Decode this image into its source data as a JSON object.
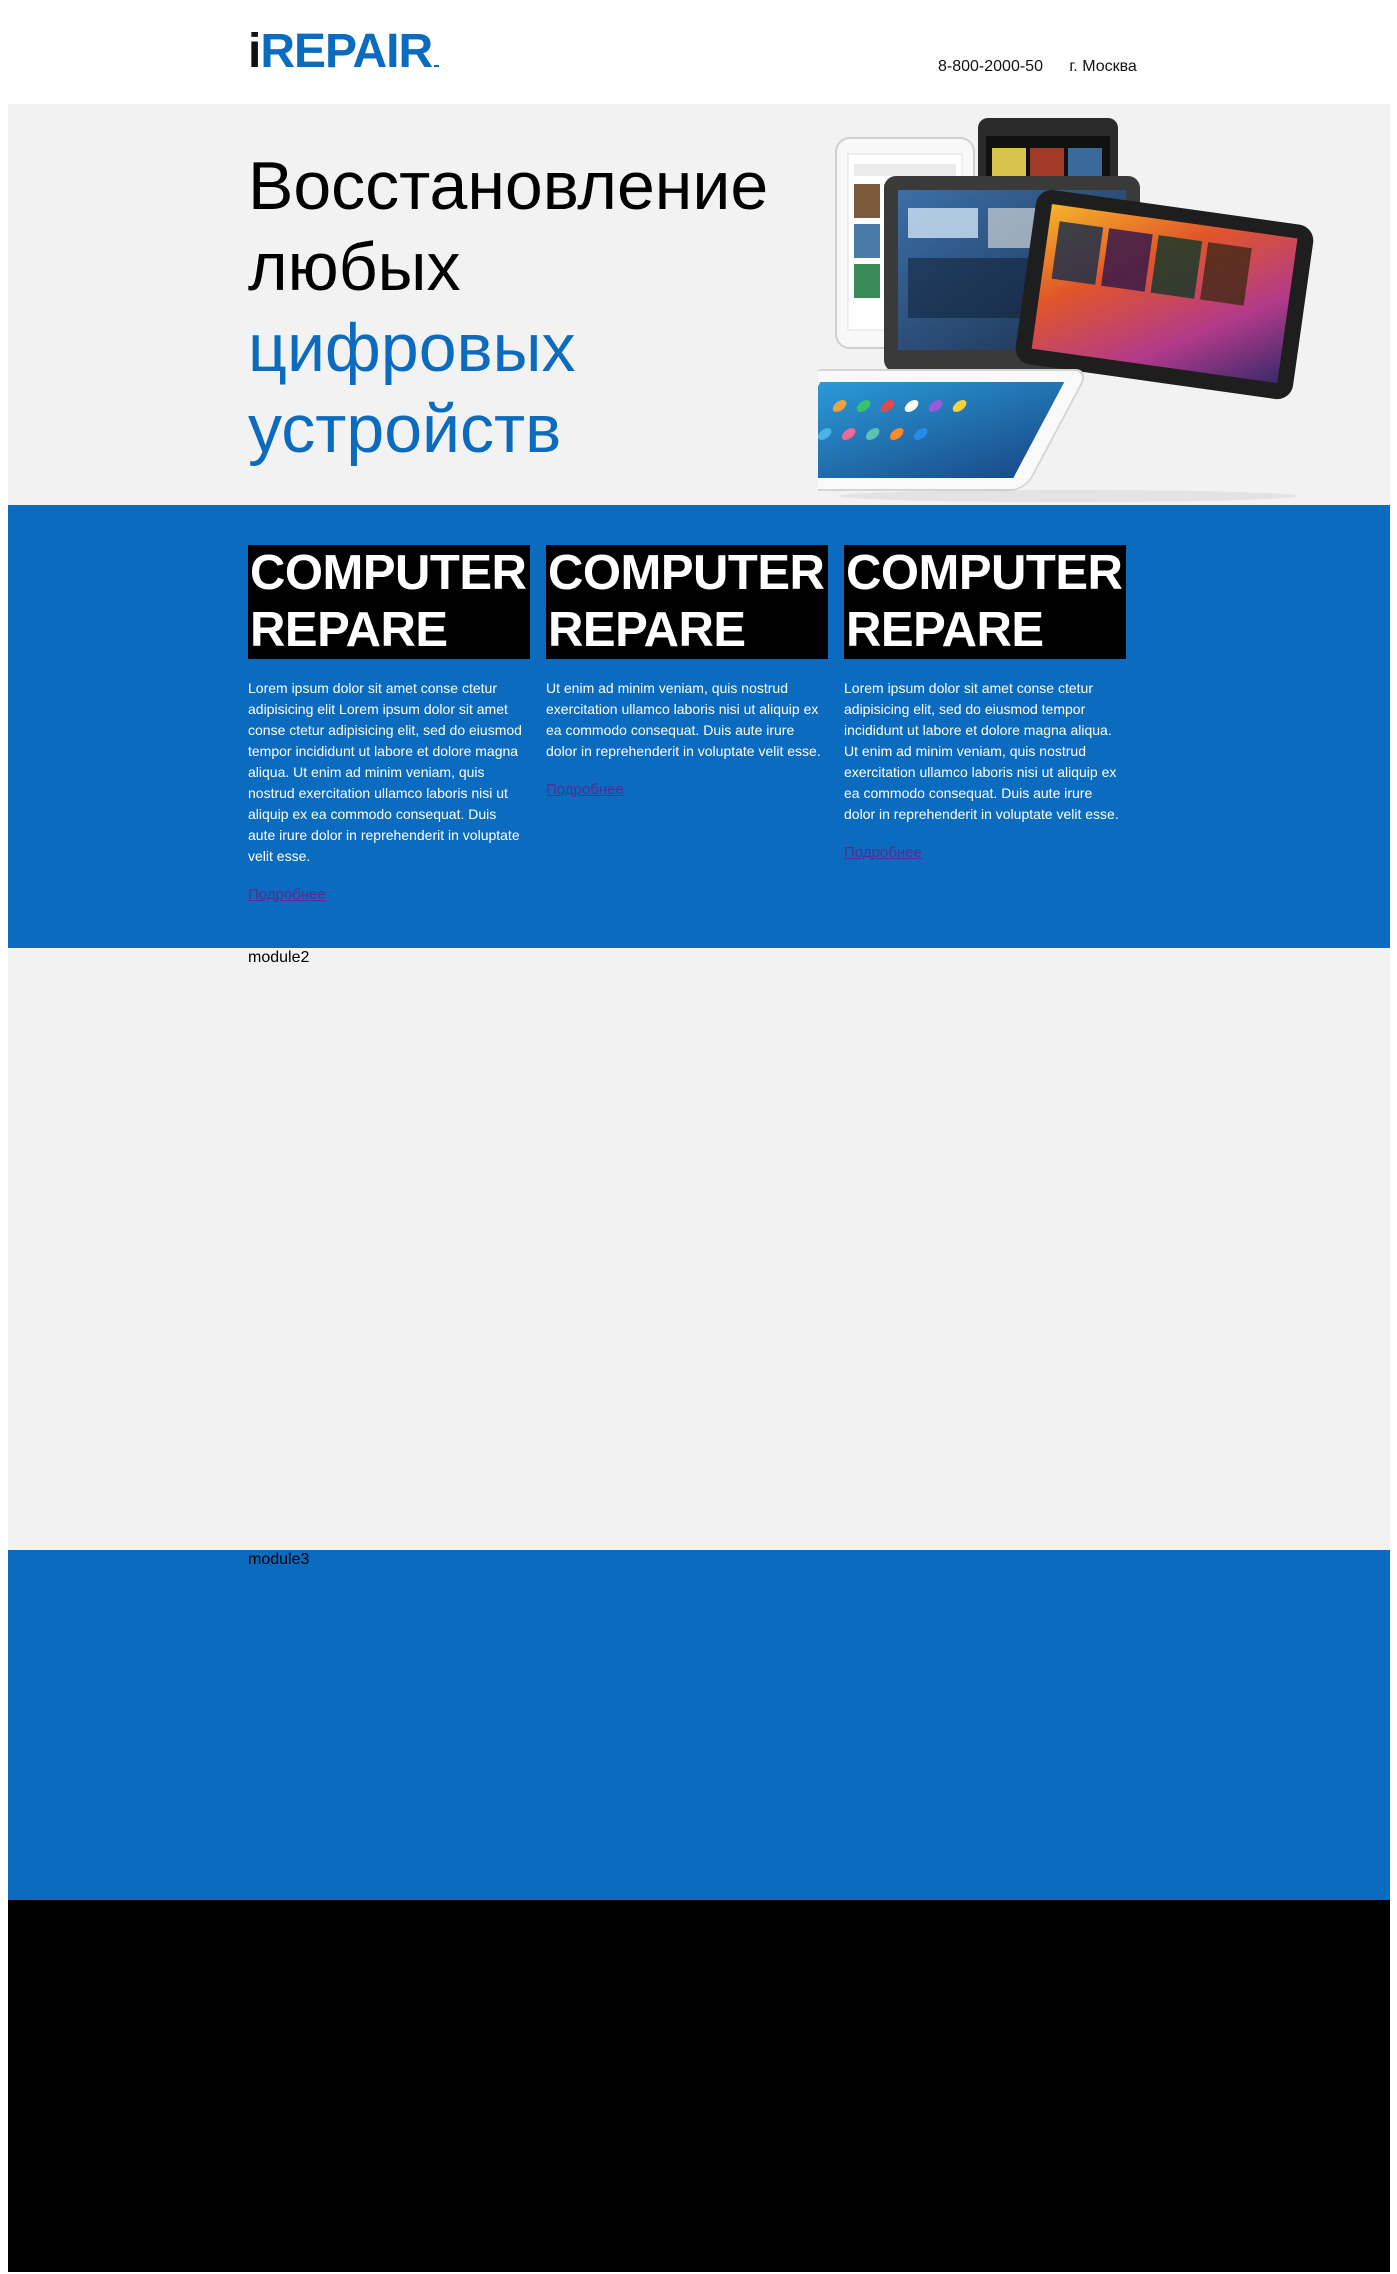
{
  "header": {
    "logo_i": "i",
    "logo_rest": "REPAIR",
    "phone": "8-800-2000-50",
    "city": "г. Москва"
  },
  "hero": {
    "title_line1": "Восстановление",
    "title_line2": "любых",
    "title_line3": "цифровых",
    "title_line4": "устройств"
  },
  "services": [
    {
      "title_line1": "COMPUTER",
      "title_line2": "REPARE",
      "text": "Lorem ipsum dolor sit amet conse ctetur adipisicing elit Lorem ipsum dolor sit amet conse ctetur adipisicing elit, sed do eiusmod tempor incididunt ut labore et dolore magna aliqua. Ut enim ad minim veniam, quis nostrud exercitation ullamco laboris nisi ut aliquip ex ea commodo consequat. Duis aute irure dolor in reprehenderit in voluptate velit esse.",
      "link": "Подробнее"
    },
    {
      "title_line1": "COMPUTER",
      "title_line2": "REPARE",
      "text": "Ut enim ad minim veniam, quis nostrud exercitation ullamco laboris nisi ut aliquip ex ea commodo consequat. Duis aute irure dolor in reprehenderit in voluptate velit esse.",
      "link": "Подробнее"
    },
    {
      "title_line1": "COMPUTER",
      "title_line2": "REPARE",
      "text": "Lorem ipsum dolor sit amet conse ctetur adipisicing elit, sed do eiusmod tempor incididunt ut labore et dolore magna aliqua. Ut enim ad minim veniam, quis nostrud exercitation ullamco laboris nisi ut aliquip ex ea commodo consequat. Duis aute irure dolor in reprehenderit in voluptate velit esse.",
      "link": "Подробнее"
    }
  ],
  "modules": {
    "module2_label": "module2",
    "module3_label": "module3"
  },
  "colors": {
    "brand_blue": "#0a6bbf",
    "light_bg": "#f2f2f2",
    "footer_bg": "#000000"
  },
  "icons": {
    "hero_image": "tablets-illustration"
  }
}
